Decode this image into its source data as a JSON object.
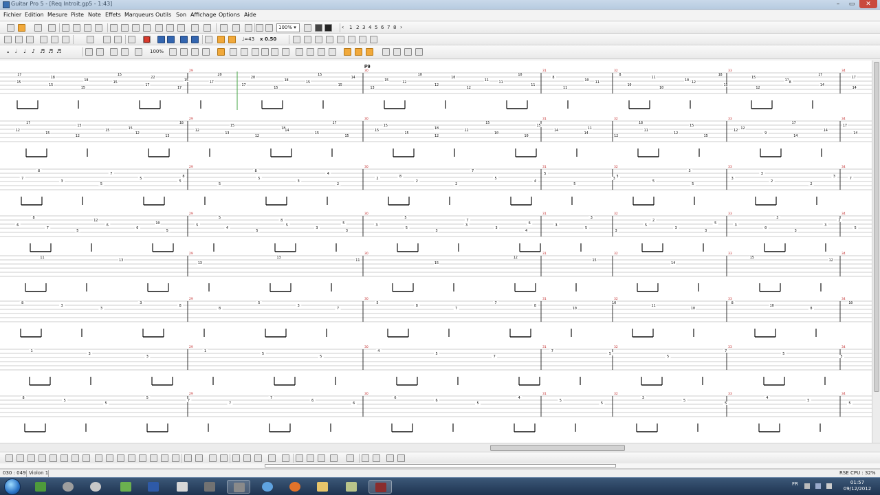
{
  "window": {
    "title": "Guitar Pro 5 - [Req Introit.gp5 - 1:43]",
    "controls": [
      "–",
      "▭",
      "✕"
    ]
  },
  "menu": {
    "items": [
      "Fichier",
      "Edition",
      "Mesure",
      "Piste",
      "Note",
      "Effets",
      "Marqueurs",
      "Outils",
      "Son",
      "Affichage",
      "Options",
      "Aide"
    ]
  },
  "toolbar1": {
    "zoom": "100%",
    "page_numbers": [
      "1",
      "2",
      "3",
      "4",
      "5",
      "6",
      "7",
      "8"
    ]
  },
  "toolbar2": {
    "tempo": "♩=43",
    "speed": "x 0.50"
  },
  "toolbar3": {
    "zoom_small": "100%"
  },
  "score": {
    "marker_label": "P9",
    "bar_numbers": [
      "29",
      "30",
      "31",
      "32",
      "33",
      "34"
    ],
    "systems": [
      {
        "rows": [
          [
            "17",
            "18",
            "18",
            "15",
            "22",
            "15",
            "20",
            "20",
            "18",
            "15",
            "14",
            "15",
            "10",
            "10",
            "11",
            "10",
            "8",
            "10",
            "8",
            "11",
            "10",
            "18",
            "15",
            "12",
            "17",
            "17"
          ],
          [
            "15",
            "15",
            "15",
            "15",
            "17",
            "17",
            "17",
            "17",
            "15",
            "15",
            "15",
            "13",
            "12",
            "12",
            "12",
            "11",
            "11",
            "11",
            "11",
            "10",
            "10",
            "12",
            "15",
            "12",
            "8",
            "14",
            "14"
          ]
        ]
      },
      {
        "rows": [
          [
            "17",
            "15",
            "15",
            "18",
            "15",
            "18",
            "17",
            "15",
            "18",
            "15",
            "15",
            "11",
            "18",
            "15",
            "12",
            "17",
            "17"
          ],
          [
            "12",
            "15",
            "12",
            "15",
            "12",
            "13",
            "12",
            "13",
            "12",
            "14",
            "15",
            "15",
            "15",
            "15",
            "12",
            "12",
            "10",
            "10",
            "14",
            "14",
            "12",
            "11",
            "12",
            "15",
            "12",
            "9",
            "14",
            "14",
            "14"
          ]
        ]
      },
      {
        "rows": [
          [
            "8",
            "7",
            "8",
            "8",
            "4",
            "8",
            "7",
            "5",
            "3",
            "3",
            "3",
            "3"
          ],
          [
            "7",
            "3",
            "5",
            "5",
            "5",
            "5",
            "5",
            "3",
            "2",
            "2",
            "2",
            "2",
            "5",
            "4",
            "5",
            "3",
            "5",
            "5",
            "3",
            "2",
            "2",
            "7"
          ]
        ]
      },
      {
        "rows": [
          [
            "8",
            "12",
            "10",
            "5",
            "8",
            "5",
            "5",
            "7",
            "6",
            "3",
            "2",
            "5",
            "3",
            "2"
          ],
          [
            "6",
            "7",
            "5",
            "6",
            "6",
            "5",
            "5",
            "4",
            "5",
            "5",
            "3",
            "3",
            "3",
            "5",
            "3",
            "3",
            "3",
            "4",
            "3",
            "5",
            "3",
            "5",
            "3",
            "3",
            "3",
            "0",
            "3",
            "3",
            "5"
          ]
        ]
      },
      {
        "rows": [
          [
            "11",
            "13",
            "13",
            "13",
            "11",
            "15",
            "12",
            "15",
            "14",
            "15",
            "12"
          ]
        ]
      },
      {
        "rows": [
          [
            "8",
            "3",
            "3",
            "3",
            "8",
            "8",
            "5",
            "3",
            "7",
            "5",
            "8",
            "7",
            "7",
            "8",
            "10",
            "10",
            "11",
            "10",
            "8",
            "10",
            "8",
            "10"
          ]
        ]
      },
      {
        "rows": [
          [
            "1",
            "3",
            "3",
            "1",
            "5",
            "5",
            "4",
            "5",
            "7",
            "7",
            "5",
            "5",
            "7",
            "5",
            "3"
          ]
        ]
      },
      {
        "rows": [
          [
            "8",
            "5",
            "5",
            "5",
            "7",
            "7",
            "7",
            "6",
            "6",
            "6",
            "6",
            "5",
            "4",
            "5",
            "5",
            "3",
            "5",
            "5",
            "4",
            "5",
            "5"
          ]
        ]
      }
    ]
  },
  "status": {
    "position": "030 : 049",
    "track": "Violon 1",
    "cpu": "RSE CPU : 32%"
  },
  "taskbar": {
    "language": "FR",
    "time": "01:57",
    "date": "09/12/2012"
  },
  "colors": {
    "bar_number_red": "#c22b2b",
    "cursor_green": "#46a646",
    "staff_line": "#333333"
  }
}
